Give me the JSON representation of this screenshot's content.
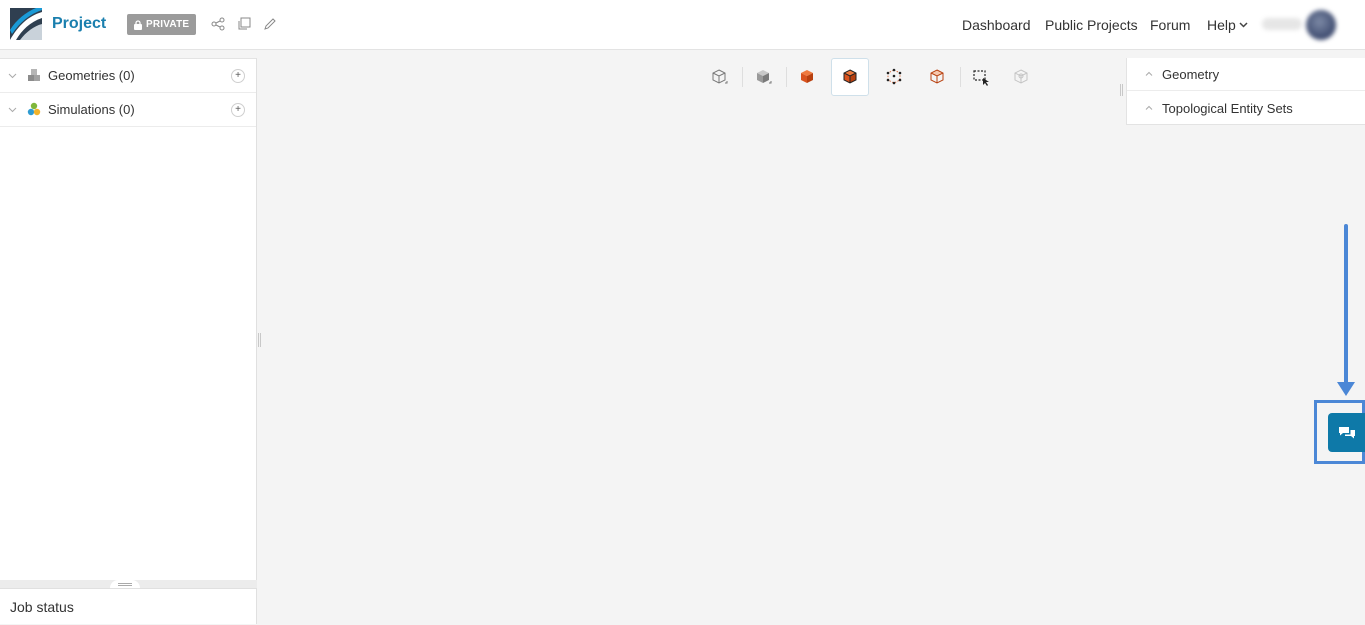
{
  "header": {
    "project_title": "Project",
    "private_label": "PRIVATE",
    "nav": {
      "dashboard": "Dashboard",
      "public_projects": "Public Projects",
      "forum": "Forum",
      "help": "Help"
    },
    "icons": [
      "share-icon",
      "copy-icon",
      "edit-icon",
      "chevron-down-icon"
    ]
  },
  "left_panel": {
    "tree": [
      {
        "label": "Geometries (0)",
        "icon": "geometry-icon"
      },
      {
        "label": "Simulations (0)",
        "icon": "simulation-icon"
      }
    ],
    "job_status_title": "Job status"
  },
  "toolbar": {
    "icons": [
      "cube-wireframe-icon",
      "cube-solid-icon",
      "cube-colored-icon",
      "cube-colored-edges-icon",
      "vertex-icon",
      "face-icon",
      "box-select-icon",
      "disabled-tool-icon"
    ]
  },
  "right_panel": {
    "sections": [
      {
        "label": "Geometry"
      },
      {
        "label": "Topological Entity Sets"
      }
    ]
  },
  "colors": {
    "brand": "#1a7fae",
    "chat_button": "#0e79a8",
    "annotation": "#4b87d6",
    "accent_orange": "#d9531e"
  }
}
